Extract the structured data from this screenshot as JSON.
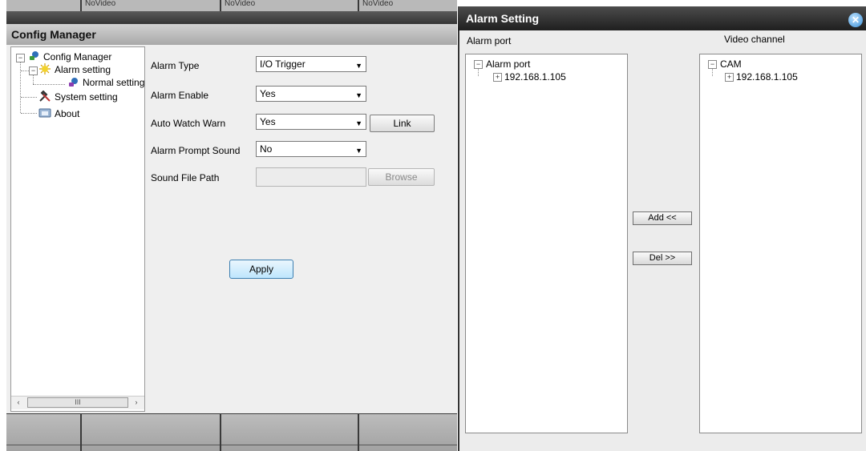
{
  "video_strip": {
    "top_labels": [
      "NoVideo",
      "NoVideo",
      "NoVideo"
    ]
  },
  "config_manager": {
    "title": "Config Manager",
    "tree": {
      "root": "Config Manager",
      "alarm_setting": "Alarm setting",
      "normal_setting": "Normal setting",
      "system_setting": "System setting",
      "about": "About"
    },
    "scrollbar": {
      "left_arrow": "‹",
      "right_arrow": "›",
      "thumb": "III"
    },
    "form": {
      "alarm_type_label": "Alarm Type",
      "alarm_type_value": "I/O Trigger",
      "alarm_enable_label": "Alarm Enable",
      "alarm_enable_value": "Yes",
      "auto_watch_warn_label": "Auto Watch Warn",
      "auto_watch_warn_value": "Yes",
      "link_button": "Link",
      "alarm_prompt_sound_label": "Alarm Prompt Sound",
      "alarm_prompt_sound_value": "No",
      "sound_file_path_label": "Sound File Path",
      "sound_file_path_value": "",
      "browse_button": "Browse",
      "apply_button": "Apply"
    }
  },
  "alarm_setting": {
    "title": "Alarm Setting",
    "close_glyph": "✕",
    "alarm_port_header": "Alarm port",
    "video_channel_header": "Video channel",
    "alarm_port_tree": {
      "root": "Alarm port",
      "child": "192.168.1.105"
    },
    "video_channel_tree": {
      "root": "CAM",
      "child": "192.168.1.105"
    },
    "add_button": "Add <<",
    "del_button": "Del >>"
  }
}
